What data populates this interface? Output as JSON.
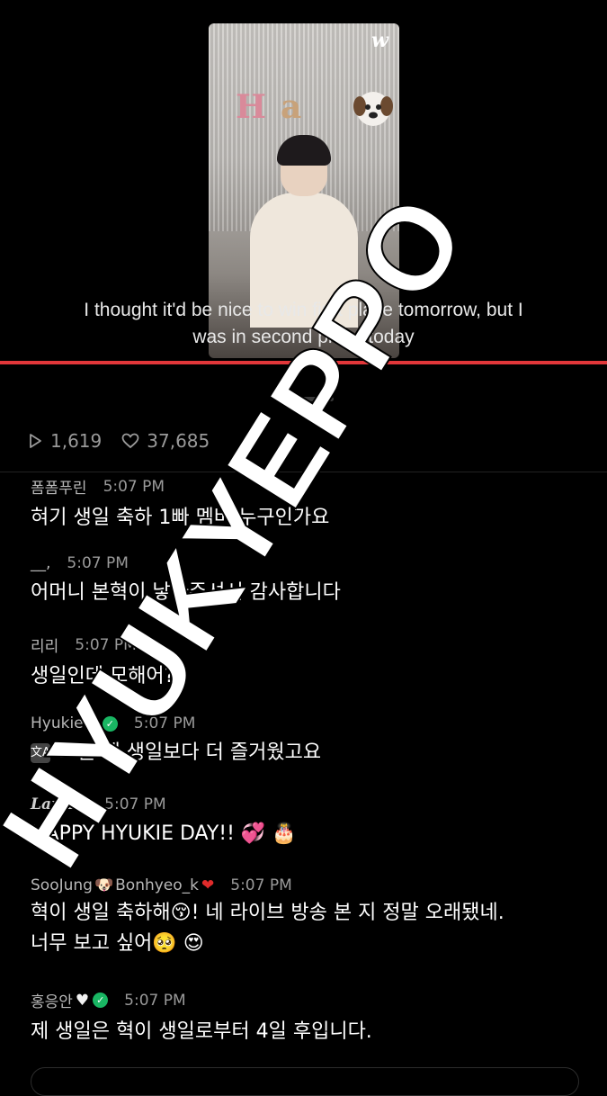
{
  "video": {
    "logo": "w",
    "balloon_letters": [
      "H",
      "a"
    ],
    "subtitle_line1": "I thought it'd be nice to win first place tomorrow, but I",
    "subtitle_line2": "was in second place today"
  },
  "stats": {
    "plays": "1,619",
    "likes": "37,685"
  },
  "comments": [
    {
      "name": "폼폼푸린",
      "time": "5:07 PM",
      "text": "혀기 생일 축하 1빠 멤버 누구인가요"
    },
    {
      "name": "__,",
      "time": "5:07 PM",
      "text": "어머니 본혁이 낳아주셔서 감사합니다"
    },
    {
      "name": "리리",
      "time": "5:07 PM",
      "text": "생일인데 모해어?"
    },
    {
      "name": "Hyukie",
      "time": "5:07 PM",
      "text": "오늘 제 생일보다 더 즐거웠고요"
    },
    {
      "name": "LaniE",
      "time": "5:07 PM",
      "text": "HAPPY HYUKIE DAY!! 💞 🎂"
    },
    {
      "name_part1": "SooJung",
      "name_part2": "Bonhyeo_k",
      "time": "5:07 PM",
      "text_line1": "혁이 생일 축하해😚! 네 라이브 방송 본 지 정말 오래됐네.",
      "text_line2": "너무 보고 싶어🥺 😍"
    },
    {
      "name": "홍응안",
      "time": "5:07 PM",
      "text": "제 생일은 혁이 생일로부터 4일 후입니다."
    }
  ],
  "watermark": "HYUKYEPPO",
  "colors": {
    "background": "#000000",
    "accent_line": "#e2373a",
    "verified_badge": "#19b663",
    "muted_text": "#9a9a9a"
  },
  "icons": {
    "play": "play-icon",
    "heart": "heart-icon",
    "translate": "translate-icon",
    "verified": "verified-badge-icon"
  }
}
